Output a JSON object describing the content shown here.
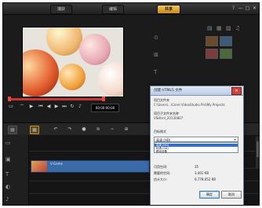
{
  "topbar": {
    "tabs": [
      "捕获",
      "编辑",
      "共享"
    ],
    "active_index": 2,
    "window_controls": [
      "?",
      "—",
      "□",
      "✕"
    ]
  },
  "player": {
    "timecode": "00:00:00:00",
    "progress": 1.0
  },
  "timeline": {
    "clip_label": "V-Game"
  },
  "dialog": {
    "title": "创建 HTML5 文件",
    "close_glyph": "✕",
    "project_folder_label": "项目文件夹",
    "project_folder_path": "C:\\Users\\...\\Corel VideoStudio Pro\\My Projects",
    "subfolder_label": "项目子文件夹名称",
    "subfolder_value": "VSHtml_20130807",
    "format_label": "目标格式",
    "format_selected": "高清 (HD)",
    "format_options": [
      "高清 (HD)",
      "标清 (SD)",
      "移动设备"
    ],
    "selected_option_index": 0,
    "stats": [
      {
        "label": "可用空间:",
        "value": "35"
      },
      {
        "label": "需要的空间:",
        "value": "3,401 KB"
      },
      {
        "label": "估计大小:",
        "value": "6,778,052 KB"
      }
    ],
    "ok_label": "确定",
    "cancel_label": "取消"
  },
  "colors": {
    "accent_tab": "#e0a830",
    "dialog_selection": "#2f6fd1",
    "scrub_bar": "#cc3333"
  }
}
